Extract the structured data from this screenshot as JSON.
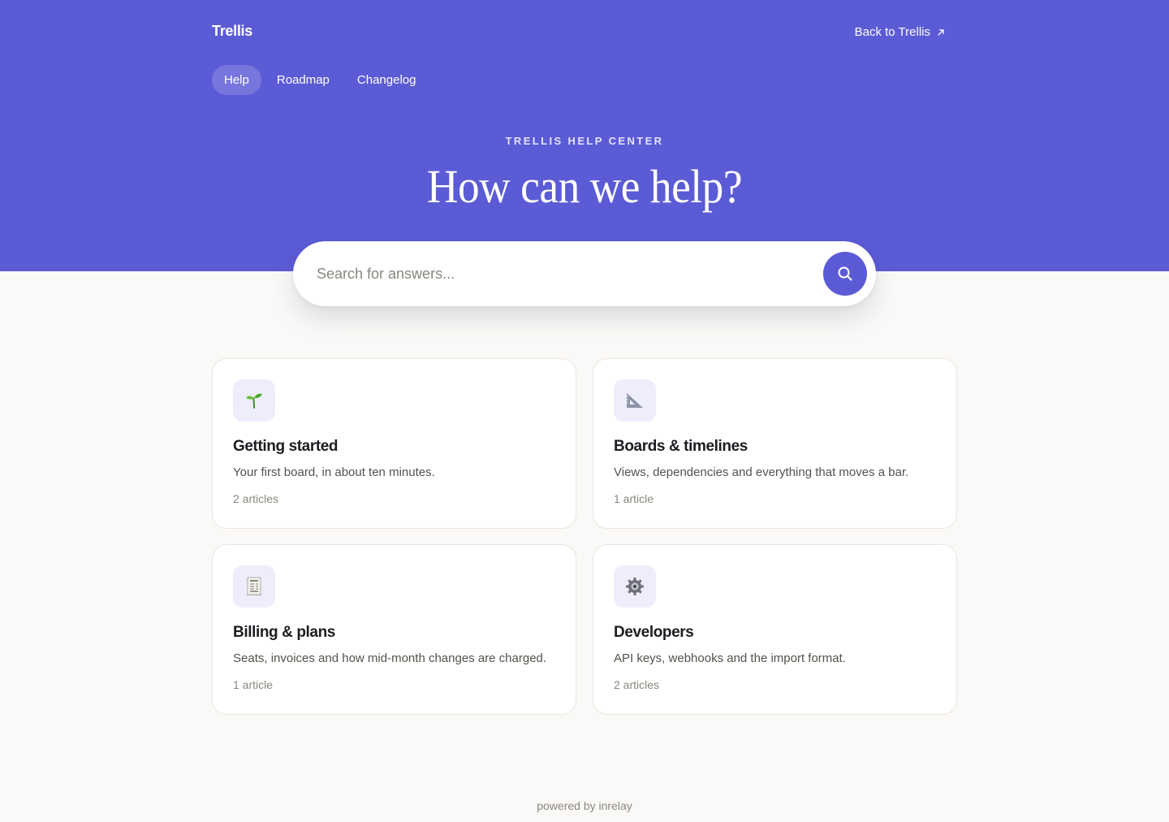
{
  "header": {
    "brand": "Trellis",
    "back_link": "Back to Trellis",
    "back_link_icon": "external-arrow-icon"
  },
  "nav": {
    "items": [
      {
        "label": "Help",
        "active": true
      },
      {
        "label": "Roadmap",
        "active": false
      },
      {
        "label": "Changelog",
        "active": false
      }
    ]
  },
  "hero": {
    "eyebrow": "TRELLIS HELP CENTER",
    "headline": "How can we help?"
  },
  "search": {
    "placeholder": "Search for answers...",
    "button_icon": "search-icon"
  },
  "categories": [
    {
      "icon": "seedling-icon",
      "title": "Getting started",
      "description": "Your first board, in about ten minutes.",
      "count": "2 articles"
    },
    {
      "icon": "triangular-ruler-icon",
      "title": "Boards & timelines",
      "description": "Views, dependencies and everything that moves a bar.",
      "count": "1 article"
    },
    {
      "icon": "receipt-icon",
      "title": "Billing & plans",
      "description": "Seats, invoices and how mid-month changes are charged.",
      "count": "1 article"
    },
    {
      "icon": "gear-icon",
      "title": "Developers",
      "description": "API keys, webhooks and the import format.",
      "count": "2 articles"
    }
  ],
  "footer": {
    "text": "powered by inrelay"
  },
  "colors": {
    "accent": "#5b5bd6",
    "background": "#faf9f7",
    "card_border": "#ebe6df",
    "icon_tile": "#eeedfc"
  }
}
